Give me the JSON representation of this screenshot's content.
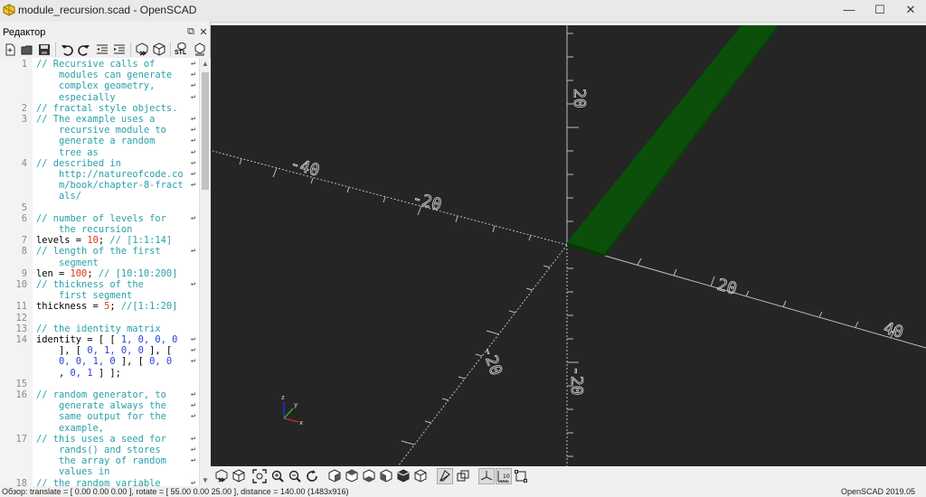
{
  "window": {
    "title": "module_recursion.scad - OpenSCAD",
    "min_glyph": "—",
    "max_glyph": "☐",
    "close_glyph": "✕"
  },
  "editor": {
    "header_label": "Редактор",
    "undock_glyph": "⧉",
    "close_glyph": "✕",
    "toolbar_icons": [
      "new-icon",
      "open-icon",
      "save-icon",
      "undo-icon",
      "redo-icon",
      "unindent-icon",
      "indent-icon",
      "preview-icon",
      "render-icon",
      "export-stl-icon",
      "send-to-print-icon"
    ],
    "stl_label": "STL",
    "wrap_mark": "↩",
    "lines": [
      {
        "n": "1",
        "parts": [
          {
            "t": "// Recursive calls of",
            "c": "cm"
          }
        ],
        "wrap": true
      },
      {
        "n": "",
        "parts": [
          {
            "t": "    modules can generate",
            "c": "cm"
          }
        ],
        "wrap": true
      },
      {
        "n": "",
        "parts": [
          {
            "t": "    complex geometry,",
            "c": "cm"
          }
        ],
        "wrap": true
      },
      {
        "n": "",
        "parts": [
          {
            "t": "    especially",
            "c": "cm"
          }
        ],
        "wrap": true
      },
      {
        "n": "2",
        "parts": [
          {
            "t": "// fractal style objects.",
            "c": "cm"
          }
        ],
        "wrap": false
      },
      {
        "n": "3",
        "parts": [
          {
            "t": "// The example uses a",
            "c": "cm"
          }
        ],
        "wrap": true
      },
      {
        "n": "",
        "parts": [
          {
            "t": "    recursive module to",
            "c": "cm"
          }
        ],
        "wrap": true
      },
      {
        "n": "",
        "parts": [
          {
            "t": "    generate a random",
            "c": "cm"
          }
        ],
        "wrap": true
      },
      {
        "n": "",
        "parts": [
          {
            "t": "    tree as",
            "c": "cm"
          }
        ],
        "wrap": true
      },
      {
        "n": "4",
        "parts": [
          {
            "t": "// described in",
            "c": "cm"
          }
        ],
        "wrap": true
      },
      {
        "n": "",
        "parts": [
          {
            "t": "    http://natureofcode.co",
            "c": "cm"
          }
        ],
        "wrap": true
      },
      {
        "n": "",
        "parts": [
          {
            "t": "    m/book/chapter-8-fract",
            "c": "cm"
          }
        ],
        "wrap": true
      },
      {
        "n": "",
        "parts": [
          {
            "t": "    als/",
            "c": "cm"
          }
        ],
        "wrap": false
      },
      {
        "n": "5",
        "parts": [],
        "wrap": false
      },
      {
        "n": "6",
        "parts": [
          {
            "t": "// number of levels for",
            "c": "cm"
          }
        ],
        "wrap": true
      },
      {
        "n": "",
        "parts": [
          {
            "t": "    the recursion",
            "c": "cm"
          }
        ],
        "wrap": false
      },
      {
        "n": "7",
        "parts": [
          {
            "t": "levels = ",
            "c": "kw"
          },
          {
            "t": "10",
            "c": "num"
          },
          {
            "t": "; ",
            "c": "kw"
          },
          {
            "t": "// [1:1:14]",
            "c": "cm"
          }
        ],
        "wrap": false
      },
      {
        "n": "8",
        "parts": [
          {
            "t": "// length of the first",
            "c": "cm"
          }
        ],
        "wrap": true
      },
      {
        "n": "",
        "parts": [
          {
            "t": "    segment",
            "c": "cm"
          }
        ],
        "wrap": false
      },
      {
        "n": "9",
        "parts": [
          {
            "t": "len = ",
            "c": "kw"
          },
          {
            "t": "100",
            "c": "num"
          },
          {
            "t": "; ",
            "c": "kw"
          },
          {
            "t": "// [10:10:200]",
            "c": "cm"
          }
        ],
        "wrap": false
      },
      {
        "n": "10",
        "parts": [
          {
            "t": "// thickness of the",
            "c": "cm"
          }
        ],
        "wrap": true
      },
      {
        "n": "",
        "parts": [
          {
            "t": "    first segment",
            "c": "cm"
          }
        ],
        "wrap": false
      },
      {
        "n": "11",
        "parts": [
          {
            "t": "thickness = ",
            "c": "kw"
          },
          {
            "t": "5",
            "c": "num"
          },
          {
            "t": "; ",
            "c": "kw"
          },
          {
            "t": "//[1:1:20]",
            "c": "cm"
          }
        ],
        "wrap": false
      },
      {
        "n": "12",
        "parts": [],
        "wrap": false
      },
      {
        "n": "13",
        "parts": [
          {
            "t": "// the identity matrix",
            "c": "cm"
          }
        ],
        "wrap": false
      },
      {
        "n": "14",
        "parts": [
          {
            "t": "identity = [ [ ",
            "c": "kw"
          },
          {
            "t": "1, 0, 0, 0",
            "c": "arr"
          }
        ],
        "wrap": true
      },
      {
        "n": "",
        "parts": [
          {
            "t": "    ], [ ",
            "c": "kw"
          },
          {
            "t": "0, 1, 0, 0",
            "c": "arr"
          },
          {
            "t": " ], [",
            "c": "kw"
          }
        ],
        "wrap": true
      },
      {
        "n": "",
        "parts": [
          {
            "t": "    ",
            "c": "kw"
          },
          {
            "t": "0, 0, 1, 0",
            "c": "arr"
          },
          {
            "t": " ], [ ",
            "c": "kw"
          },
          {
            "t": "0, 0",
            "c": "arr"
          }
        ],
        "wrap": true
      },
      {
        "n": "",
        "parts": [
          {
            "t": "    , ",
            "c": "kw"
          },
          {
            "t": "0, 1",
            "c": "arr"
          },
          {
            "t": " ] ];",
            "c": "kw"
          }
        ],
        "wrap": false
      },
      {
        "n": "15",
        "parts": [],
        "wrap": false
      },
      {
        "n": "16",
        "parts": [
          {
            "t": "// random generator, to",
            "c": "cm"
          }
        ],
        "wrap": true
      },
      {
        "n": "",
        "parts": [
          {
            "t": "    generate always the",
            "c": "cm"
          }
        ],
        "wrap": true
      },
      {
        "n": "",
        "parts": [
          {
            "t": "    same output for the",
            "c": "cm"
          }
        ],
        "wrap": true
      },
      {
        "n": "",
        "parts": [
          {
            "t": "    example,",
            "c": "cm"
          }
        ],
        "wrap": false
      },
      {
        "n": "17",
        "parts": [
          {
            "t": "// this uses a seed for",
            "c": "cm"
          }
        ],
        "wrap": true
      },
      {
        "n": "",
        "parts": [
          {
            "t": "    rands() and stores",
            "c": "cm"
          }
        ],
        "wrap": true
      },
      {
        "n": "",
        "parts": [
          {
            "t": "    the array of random",
            "c": "cm"
          }
        ],
        "wrap": true
      },
      {
        "n": "",
        "parts": [
          {
            "t": "    values in",
            "c": "cm"
          }
        ],
        "wrap": false
      },
      {
        "n": "18",
        "parts": [
          {
            "t": "// the random variable",
            "c": "cm"
          }
        ],
        "wrap": true
      }
    ]
  },
  "viewport": {
    "background": "#252525",
    "model_color": "#0a4a0a",
    "axis_labels": {
      "x_pos_20": "20",
      "x_pos_40": "40",
      "x_neg_20": "-20",
      "x_neg_40": "-40",
      "y_neg_20": "-20",
      "z_pos_20": "20",
      "z_neg_20": "-20"
    },
    "gizmo": {
      "x": "x",
      "y": "y",
      "z": "z"
    }
  },
  "view_toolbar": {
    "icons": [
      "preview-icon",
      "render-icon",
      "view-all-icon",
      "zoom-in-icon",
      "zoom-out-icon",
      "reset-view-icon",
      "view-right-icon",
      "view-top-icon",
      "view-bottom-icon",
      "view-left-icon",
      "view-front-icon",
      "view-back-icon",
      "perspective-icon",
      "orthogonal-icon",
      "show-axes-icon",
      "show-scale-markers-icon",
      "show-edges-icon"
    ]
  },
  "status": {
    "left": "Обзор: translate = [ 0.00 0.00 0.00 ], rotate = [ 55.00 0.00 25.00 ], distance = 140.00 (1483x916)",
    "right": "OpenSCAD 2019.05"
  }
}
